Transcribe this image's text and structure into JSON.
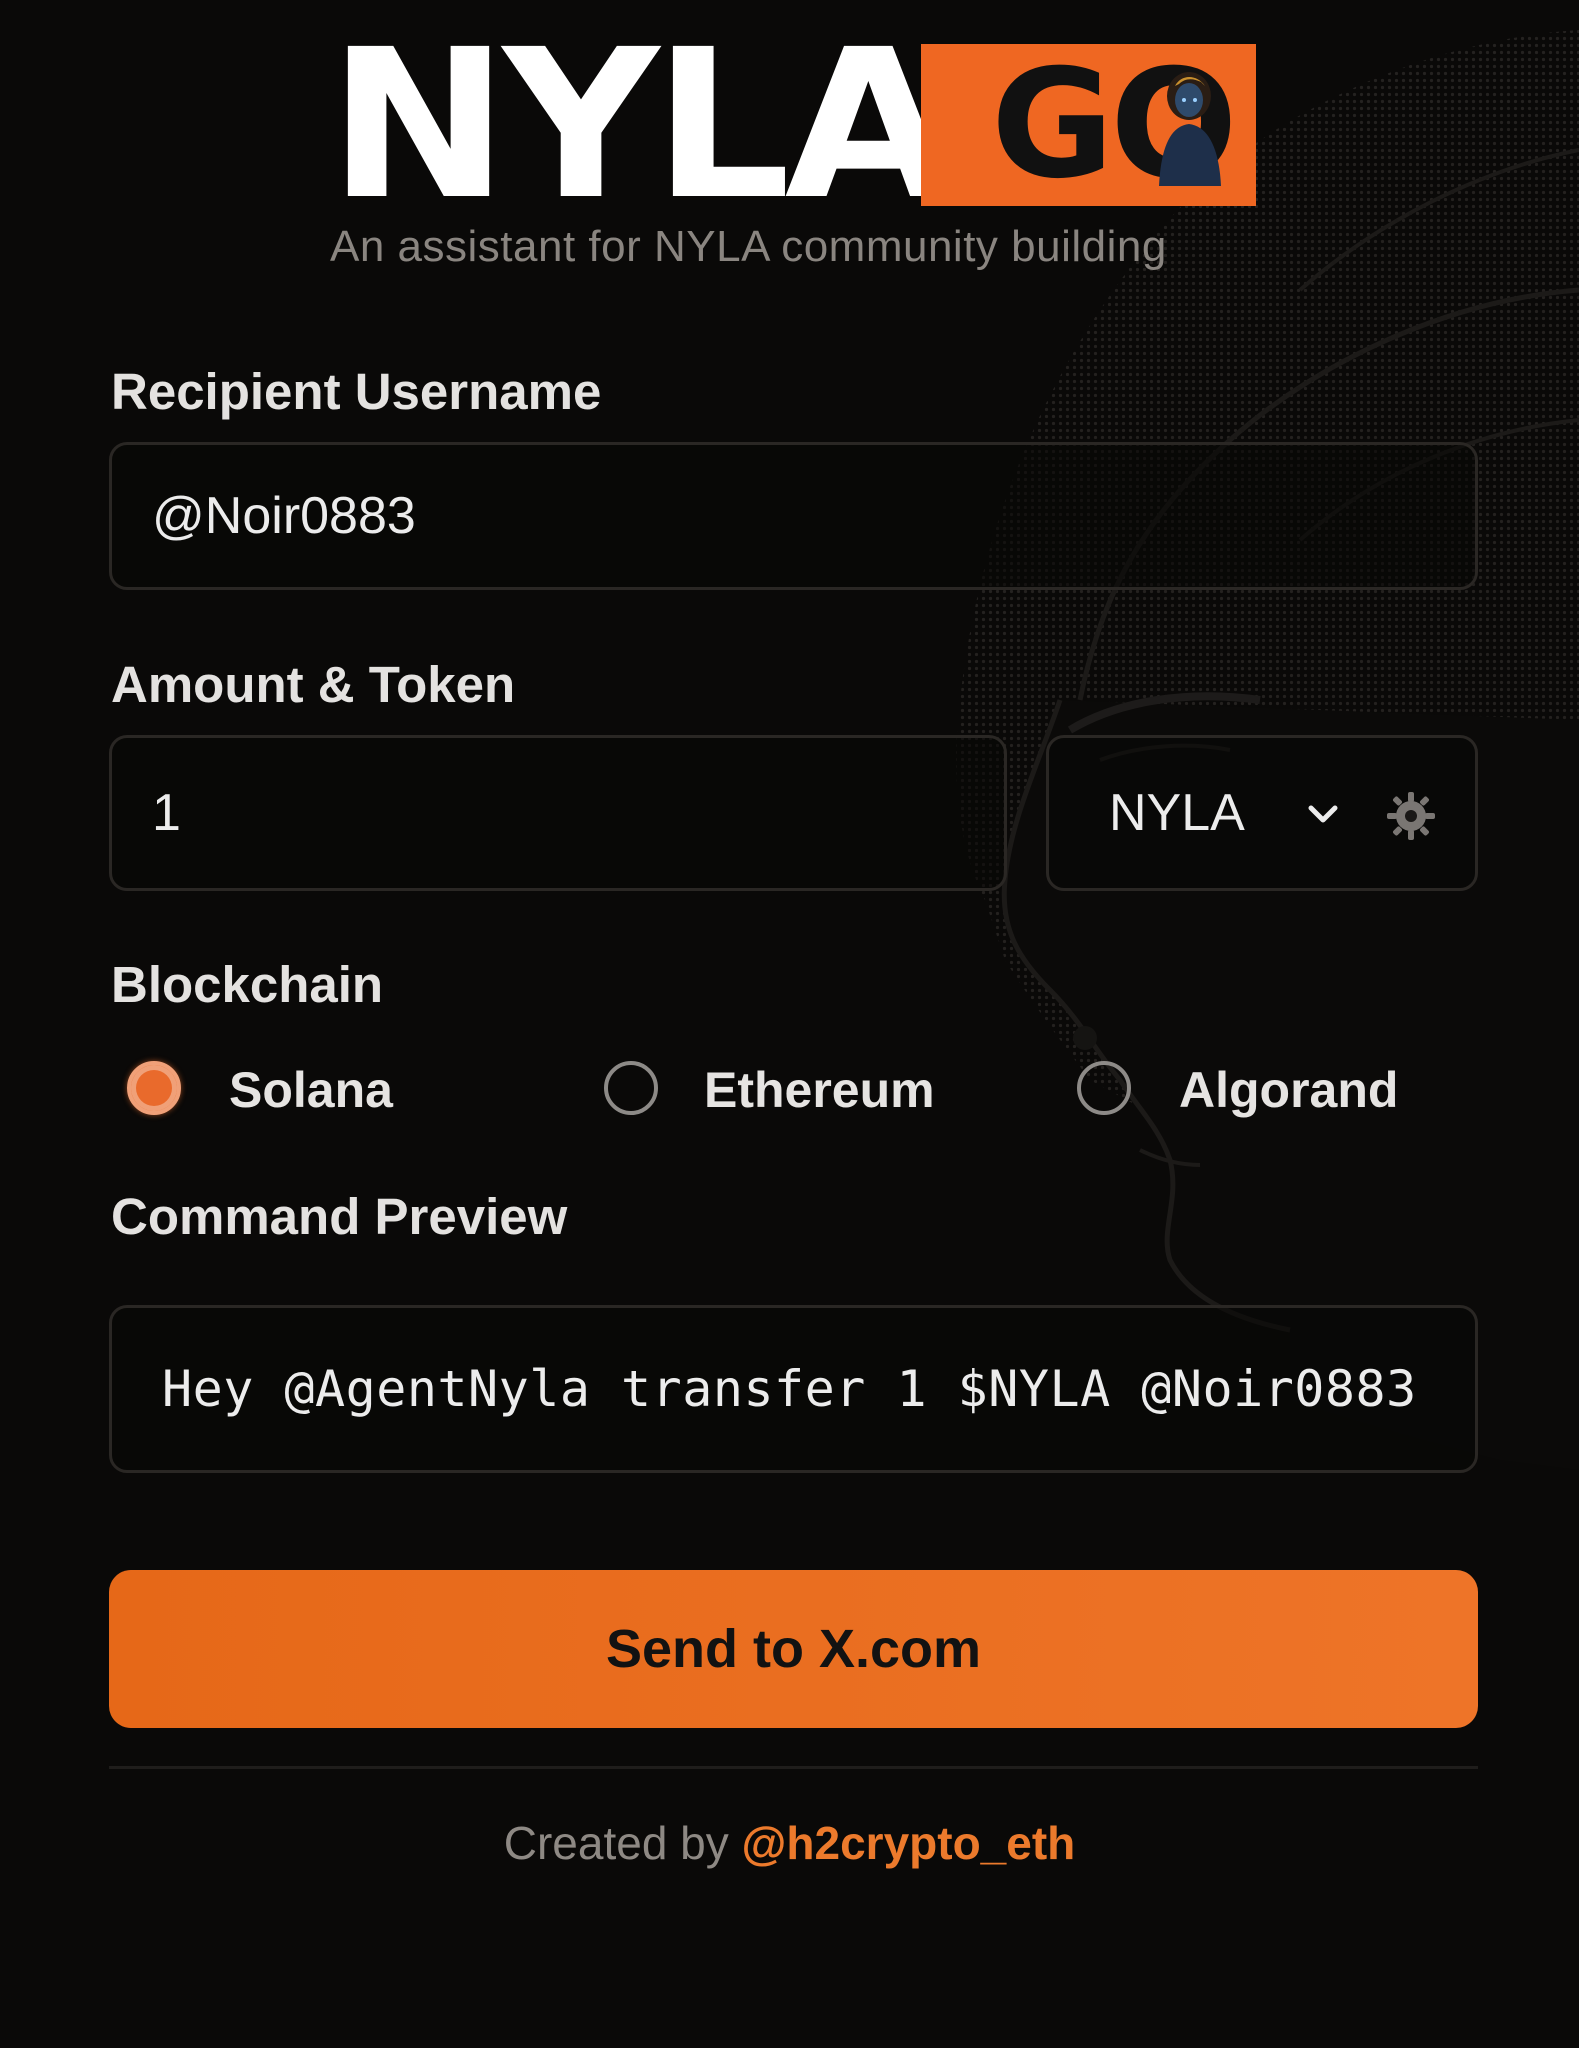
{
  "brand": {
    "logo_text": "NYLA",
    "logo_suffix": "GO",
    "tagline": "An assistant for NYLA community building",
    "accent_color": "#ef6722"
  },
  "recipient": {
    "label": "Recipient Username",
    "value": "@Noir0883"
  },
  "amount": {
    "label": "Amount & Token",
    "value": "1",
    "token_selected": "NYLA",
    "token_icon": "chevron-down-icon",
    "settings_icon": "gear-icon"
  },
  "blockchain": {
    "label": "Blockchain",
    "options": [
      {
        "label": "Solana",
        "checked": true
      },
      {
        "label": "Ethereum",
        "checked": false
      },
      {
        "label": "Algorand",
        "checked": false
      }
    ]
  },
  "preview": {
    "label": "Command Preview",
    "text": "Hey @AgentNyla transfer 1 $NYLA @Noir0883"
  },
  "send_button": {
    "label": "Send to X.com",
    "color": "#ea6d1f"
  },
  "footer": {
    "prefix": "Created by",
    "handle": "@h2crypto_eth"
  }
}
